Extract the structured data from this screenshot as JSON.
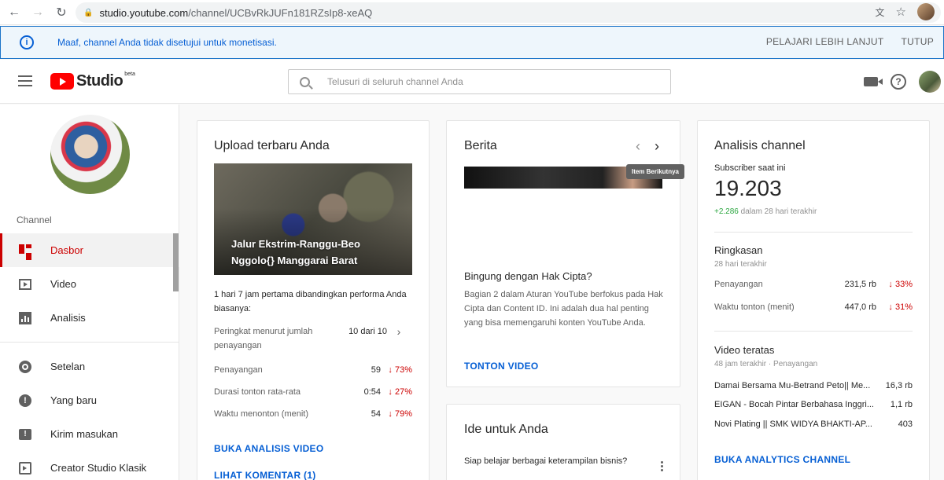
{
  "browser": {
    "url_host": "studio.youtube.com",
    "url_path": "/channel/UCBvRkJUFn181RZsIp8-xeAQ"
  },
  "banner": {
    "message": "Maaf, channel Anda tidak disetujui untuk monetisasi.",
    "learn_more": "PELAJARI LEBIH LANJUT",
    "close": "TUTUP"
  },
  "topbar": {
    "logo": "Studio",
    "logo_badge": "beta",
    "search_placeholder": "Telusuri di seluruh channel Anda"
  },
  "sidebar": {
    "section_label": "Channel",
    "items": [
      {
        "label": "Dasbor",
        "icon": "dashboard-icon"
      },
      {
        "label": "Video",
        "icon": "video-icon"
      },
      {
        "label": "Analisis",
        "icon": "analytics-icon"
      },
      {
        "label": "Setelan",
        "icon": "gear-icon"
      },
      {
        "label": "Yang baru",
        "icon": "whats-new-icon"
      },
      {
        "label": "Kirim masukan",
        "icon": "feedback-icon"
      },
      {
        "label": "Creator Studio Klasik",
        "icon": "classic-studio-icon"
      }
    ]
  },
  "upload": {
    "title": "Upload terbaru Anda",
    "video_title_line1": "Jalur Ekstrim-Ranggu-Beo",
    "video_title_line2": "Nggolo{} Manggarai Barat",
    "intro": "1 hari 7 jam pertama dibandingkan performa Anda biasanya:",
    "rank_label": "Peringkat menurut jumlah penayangan",
    "rank_value": "10 dari 10",
    "stats": [
      {
        "label": "Penayangan",
        "value": "59",
        "change": "73%"
      },
      {
        "label": "Durasi tonton rata-rata",
        "value": "0:54",
        "change": "27%"
      },
      {
        "label": "Waktu menonton (menit)",
        "value": "54",
        "change": "79%"
      }
    ],
    "link_analysis": "BUKA ANALISIS VIDEO",
    "link_comments": "LIHAT KOMENTAR (1)"
  },
  "news": {
    "title": "Berita",
    "tooltip": "Item Berikutnya",
    "headline": "Bingung dengan Hak Cipta?",
    "body": "Bagian 2 dalam Aturan YouTube berfokus pada Hak Cipta dan Content ID. Ini adalah dua hal penting yang bisa memengaruhi konten YouTube Anda.",
    "link": "TONTON VIDEO"
  },
  "ideas": {
    "title": "Ide untuk Anda",
    "text": "Siap belajar berbagai keterampilan bisnis?"
  },
  "analytics": {
    "title": "Analisis channel",
    "subscriber_label": "Subscriber saat ini",
    "subscriber_count": "19.203",
    "subscriber_change": "+2.286",
    "subscriber_change_period": "dalam 28 hari terakhir",
    "summary_title": "Ringkasan",
    "summary_period": "28 hari terakhir",
    "summary": [
      {
        "label": "Penayangan",
        "value": "231,5 rb",
        "change": "33%"
      },
      {
        "label": "Waktu tonton (menit)",
        "value": "447,0 rb",
        "change": "31%"
      }
    ],
    "top_title": "Video teratas",
    "top_period": "48 jam terakhir · Penayangan",
    "top_videos": [
      {
        "title": "Damai Bersama Mu-Betrand Peto|| Me...",
        "views": "16,3 rb"
      },
      {
        "title": "EIGAN - Bocah Pintar Berbahasa Inggri...",
        "views": "1,1 rb"
      },
      {
        "title": "Novi Plating || SMK WIDYA BHAKTI-AP...",
        "views": "403"
      }
    ],
    "link": "BUKA ANALYTICS CHANNEL"
  },
  "colors": {
    "accent_red": "#cc0000",
    "link_blue": "#065fd4",
    "positive_green": "#2ba640"
  }
}
